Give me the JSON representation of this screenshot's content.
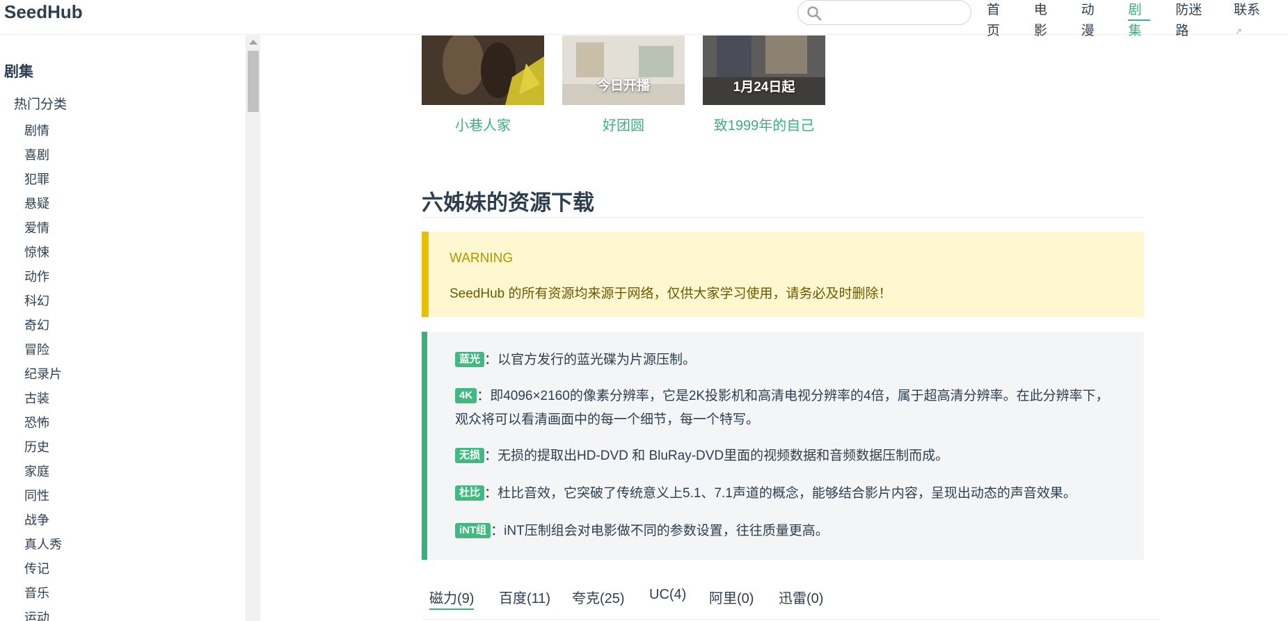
{
  "header": {
    "logo": "SeedHub",
    "search": {
      "placeholder": ""
    },
    "nav": [
      {
        "label": "首页"
      },
      {
        "label": "电影"
      },
      {
        "label": "动漫"
      },
      {
        "label": "剧集",
        "active": true
      },
      {
        "label": "防迷路"
      },
      {
        "label": "联系"
      }
    ]
  },
  "sidebar": {
    "title": "剧集",
    "group": "热门分类",
    "items": [
      "剧情",
      "喜剧",
      "犯罪",
      "悬疑",
      "爱情",
      "惊悚",
      "动作",
      "科幻",
      "奇幻",
      "冒险",
      "纪录片",
      "古装",
      "恐怖",
      "历史",
      "家庭",
      "同性",
      "战争",
      "真人秀",
      "传记",
      "音乐",
      "运动"
    ]
  },
  "related": [
    {
      "title": "小巷人家",
      "poster_text": "",
      "color": "#5a4a38"
    },
    {
      "title": "好团圆",
      "poster_text": "今日开播",
      "color": "#d9d4cc"
    },
    {
      "title": "致1999年的自己",
      "poster_text": "1月24日起",
      "color": "#6b6a6a"
    }
  ],
  "section_title": "六姊妹的资源下载",
  "warning": {
    "title": "WARNING",
    "text": "SeedHub 的所有资源均来源于网络，仅供大家学习使用，请务必及时删除！"
  },
  "tips": [
    {
      "badge": "蓝光",
      "text": "：以官方发行的蓝光碟为片源压制。"
    },
    {
      "badge": "4K",
      "text": "：即4096×2160的像素分辨率，它是2K投影机和高清电视分辨率的4倍，属于超高清分辨率。在此分辨率下，观众将可以看清画面中的每一个细节，每一个特写。"
    },
    {
      "badge": "无损",
      "text": "：无损的提取出HD-DVD 和 BluRay-DVD里面的视频数据和音频数据压制而成。"
    },
    {
      "badge": "杜比",
      "text": "：杜比音效，它突破了传统意义上5.1、7.1声道的概念，能够结合影片内容，呈现出动态的声音效果。"
    },
    {
      "badge": "iNT组",
      "text": "：iNT压制组会对电影做不同的参数设置，往往质量更高。"
    }
  ],
  "tabs": [
    {
      "label": "磁力(9)",
      "active": true
    },
    {
      "label": "百度(11)"
    },
    {
      "label": "夸克(25)"
    },
    {
      "label": "UC(4)"
    },
    {
      "label": "阿里(0)"
    },
    {
      "label": "迅雷(0)"
    }
  ],
  "colors": {
    "accent": "#3eaf7c",
    "warning_bg": "#fff7d0",
    "warning_border": "#e7c000",
    "tip_bg": "#f3f5f7"
  }
}
